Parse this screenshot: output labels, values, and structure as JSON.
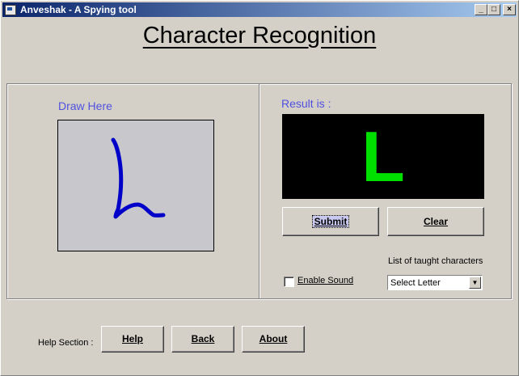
{
  "window": {
    "title": "Anveshak - A Spying tool",
    "controls": {
      "minimize": "_",
      "maximize": "□",
      "close": "×"
    }
  },
  "heading": "Character Recognition",
  "draw_panel": {
    "label": "Draw Here",
    "stroke_color": "#0000c8"
  },
  "result_panel": {
    "label": "Result is :",
    "recognized": "L",
    "result_color": "#00e000",
    "submit_label": "Submit",
    "clear_label": "Clear",
    "enable_sound_label": "Enable Sound",
    "enable_sound_checked": false,
    "taught_label": "List of taught characters",
    "select_value": "Select Letter"
  },
  "help_section": {
    "label": "Help Section :",
    "help_label": "Help",
    "back_label": "Back",
    "about_label": "About"
  },
  "colors": {
    "titlebar_start": "#0a246a",
    "titlebar_end": "#a6caf0",
    "label_blue": "#5050e0"
  }
}
